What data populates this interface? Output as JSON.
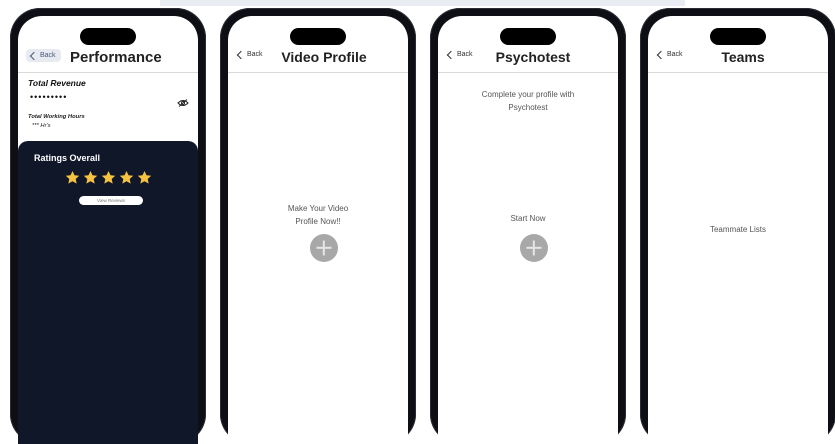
{
  "screens": [
    {
      "back_label": "Back",
      "title": "Performance",
      "total_revenue_label": "Total Revenue",
      "total_revenue_value": "•••••••••",
      "total_working_hours_label": "Total Working Hours",
      "total_working_hours_value": "*** Hr's",
      "ratings_title": "Ratings Overall",
      "stars": 5,
      "view_reviews_label": "View Reviews"
    },
    {
      "back_label": "Back",
      "title": "Video Profile",
      "prompt_line1": "Make Your Video",
      "prompt_line2": "Profile Now!!"
    },
    {
      "back_label": "Back",
      "title": "Psychotest",
      "intro_line1": "Complete your profile with",
      "intro_line2": "Psychotest",
      "start_label": "Start Now"
    },
    {
      "back_label": "Back",
      "title": "Teams",
      "body_label": "Teammate Lists"
    }
  ],
  "colors": {
    "phone_frame": "#0d0f14",
    "dark_panel": "#0f1729",
    "star": "#f5c242",
    "plus_circle": "#a8a8a8"
  }
}
